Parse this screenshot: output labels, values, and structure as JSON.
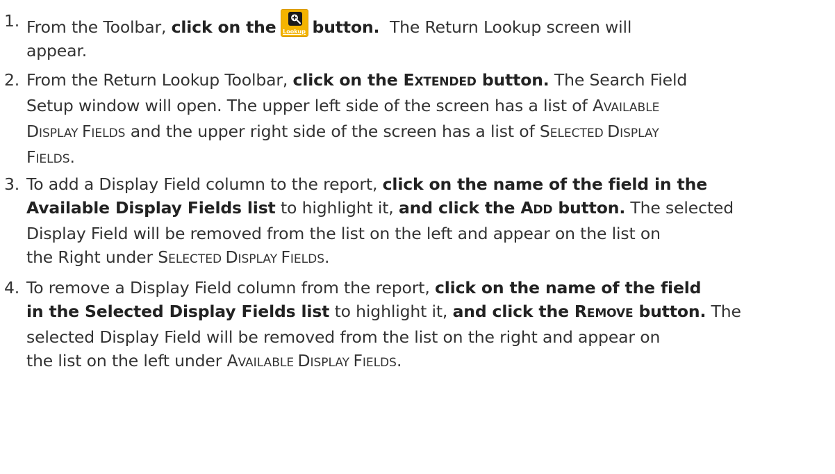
{
  "steps": [
    {
      "number": "1.",
      "l1_a": "From the Toolbar, ",
      "l1_b": "click on the",
      "lookup_icon_label": "Lookup",
      "l1_c": "button.",
      "l1_d": "  The Return Lookup screen will",
      "l2": "appear."
    },
    {
      "number": "2.",
      "l1_a": "From the Return Lookup Toolbar, ",
      "l1_b": "click on the ",
      "l1_sc_first": "E",
      "l1_sc_rest": "XTENDED",
      "l1_c": " button.",
      "l1_d": " The Search Field",
      "l2_a": "Setup window will open. The upper left side of the screen has a list of ",
      "l2_sc_first": "A",
      "l2_sc_rest": "VAILABLE",
      "l3_sc1_first": "D",
      "l3_sc1_rest": "ISPLAY ",
      "l3_sc2_first": "F",
      "l3_sc2_rest": "IELDS",
      "l3_b": " and the upper right side of the screen has a list of ",
      "l3_sc3_first": "S",
      "l3_sc3_rest": "ELECTED ",
      "l3_sc4_first": "D",
      "l3_sc4_rest": "ISPLAY",
      "l4_sc_first": "F",
      "l4_sc_rest": "IELDS",
      "l4_end": "."
    },
    {
      "number": "3.",
      "l1_a": "To add a Display Field column to the report, ",
      "l1_b": "click on the name of the field in the",
      "l2_a": "Available Display Fields list",
      "l2_b": " to highlight it, ",
      "l2_c": "and click the ",
      "l2_sc_first": "A",
      "l2_sc_rest": "DD",
      "l2_d": " button.",
      "l2_e": " The selected",
      "l3": "Display Field will be removed from the list on the left and appear on the list on",
      "l4_a": "the Right under ",
      "l4_sc1_first": "S",
      "l4_sc1_rest": "ELECTED ",
      "l4_sc2_first": "D",
      "l4_sc2_rest": "ISPLAY ",
      "l4_sc3_first": "F",
      "l4_sc3_rest": "IELDS",
      "l4_end": "."
    },
    {
      "number": "4.",
      "l1_a": "To remove a Display Field column from the report, ",
      "l1_b": "click on the name of the field",
      "l2_a": "in the Selected Display Fields list",
      "l2_b": " to highlight it, ",
      "l2_c": "and click the ",
      "l2_sc_first": "R",
      "l2_sc_rest": "EMOVE",
      "l2_d": " button.",
      "l2_e": " The",
      "l3": "selected Display Field will be removed from the list on the right and appear on",
      "l4_a": "the list on the left under ",
      "l4_sc1_first": "A",
      "l4_sc1_rest": "VAILABLE ",
      "l4_sc2_first": "D",
      "l4_sc2_rest": "ISPLAY ",
      "l4_sc3_first": "F",
      "l4_sc3_rest": "IELDS",
      "l4_end": "."
    }
  ],
  "colors": {
    "text": "#333333",
    "lookup_button": "#f4b400"
  },
  "icons": {
    "lookup": "magnifier-plus-icon"
  }
}
